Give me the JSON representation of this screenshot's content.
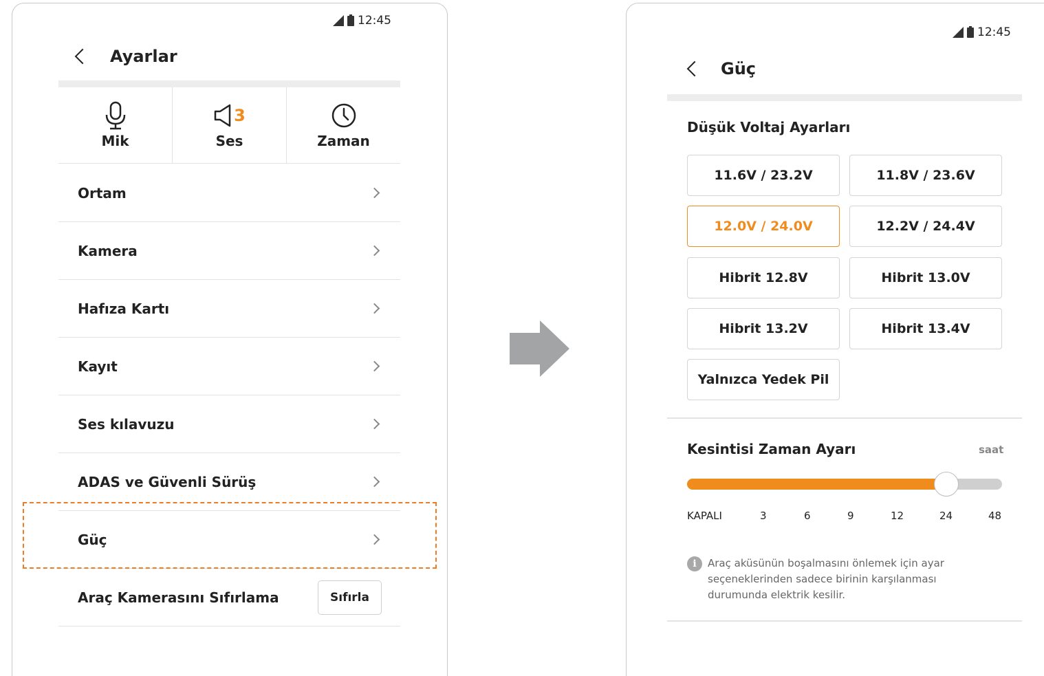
{
  "status_bar": {
    "time": "12:45"
  },
  "settings_screen": {
    "title": "Ayarlar",
    "quick_tiles": [
      {
        "label": "Mik",
        "icon": "microphone-icon"
      },
      {
        "label": "Ses",
        "icon": "speaker-icon",
        "badge": "3"
      },
      {
        "label": "Zaman",
        "icon": "clock-icon"
      }
    ],
    "menu_items": [
      {
        "label": "Ortam"
      },
      {
        "label": "Kamera"
      },
      {
        "label": "Hafıza Kartı"
      },
      {
        "label": "Kayıt"
      },
      {
        "label": "Ses kılavuzu"
      },
      {
        "label": "ADAS ve Güvenli Sürüş"
      },
      {
        "label": "Güç"
      }
    ],
    "reset_row": {
      "label": "Araç Kamerasını Sıfırlama",
      "button_label": "Sıfırla"
    },
    "highlighted_item": "Güç"
  },
  "power_screen": {
    "title": "Güç",
    "low_voltage": {
      "title": "Düşük Voltaj Ayarları",
      "options": [
        "11.6V / 23.2V",
        "11.8V / 23.6V",
        "12.0V / 24.0V",
        "12.2V / 24.4V",
        "Hibrit 12.8V",
        "Hibrit 13.0V",
        "Hibrit 13.2V",
        "Hibrit 13.4V",
        "Yalnızca Yedek Pil"
      ],
      "selected": "12.0V / 24.0V"
    },
    "cutoff_timer": {
      "title": "Kesintisi Zaman Ayarı",
      "unit": "saat",
      "ticks": [
        "KAPALI",
        "3",
        "6",
        "9",
        "12",
        "24",
        "48"
      ],
      "selected": "24"
    },
    "info_text": "Araç aküsünün boşalmasını önlemek için ayar seçeneklerinden sadece birinin karşılanması durumunda elektrik kesilir."
  },
  "colors": {
    "accent": "#f08c1e",
    "highlight_border": "#ef7c22",
    "slider_track": "#cfcfcf"
  }
}
